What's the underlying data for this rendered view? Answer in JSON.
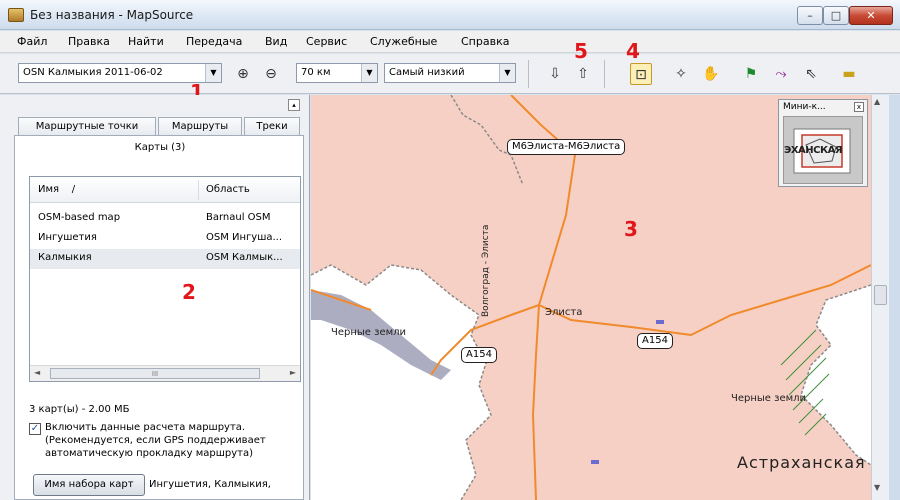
{
  "window": {
    "title": "Без названия - MapSource",
    "min_glyph": "–",
    "max_glyph": "□",
    "close_glyph": "✕"
  },
  "menu": [
    "Файл",
    "Правка",
    "Найти",
    "Передача",
    "Вид",
    "Сервис",
    "Служебные",
    "Справка"
  ],
  "toolbar": {
    "map_product": "OSN Калмыкия 2011-06-02",
    "zoom_scale": "70 км",
    "detail_level": "Самый низкий",
    "icons": [
      "zoom-in-icon",
      "zoom-out-icon",
      "receive-from-device-icon",
      "send-to-device-icon",
      "map-select-tool-icon",
      "zoom-tool-icon",
      "hand-tool-icon",
      "waypoint-flag-icon",
      "route-tool-icon",
      "select-pointer-icon",
      "measure-tool-icon"
    ],
    "combo_arrow": "▼",
    "glyphs": {
      "zoom_in": "⊕",
      "zoom_out": "⊖",
      "receive": "⇩",
      "send": "⇧",
      "map_select": "⊡",
      "zoom_tool": "✧",
      "hand": "✋",
      "flag": "⚑",
      "route": "⤳",
      "pointer": "⇖",
      "measure": "▬"
    }
  },
  "callouts": {
    "c1": "1",
    "c2": "2",
    "c3": "3",
    "c4": "4",
    "c5": "5"
  },
  "left_panel": {
    "collapse_glyph": "▴",
    "tabs": {
      "waypoints": "Маршрутные точки",
      "routes": "Маршруты",
      "tracks": "Треки"
    },
    "maps_tab_title": "Карты (3)",
    "columns": {
      "name": "Имя",
      "sort_glyph": "/",
      "area": "Область"
    },
    "rows": [
      {
        "name": "OSM-based map",
        "area": "Barnaul OSM"
      },
      {
        "name": "Ингушетия",
        "area": "OSM Ингуша..."
      },
      {
        "name": "Калмыкия",
        "area": "OSM Калмык..."
      }
    ],
    "hscroll": {
      "left": "◄",
      "thumb": "III",
      "right": "►"
    },
    "maps_count": "3 карт(ы) - 2.00 МБ",
    "checkbox_checked": true,
    "checkbox_mark": "✓",
    "checkbox_label": "Включить данные расчета маршрута. (Рекомендуется, если GPS поддерживает автоматическую прокладку маршрута)",
    "mapset_button": "Имя набора карт",
    "mapset_value": "Ингушетия, Калмыкия,"
  },
  "map": {
    "labels": {
      "road_top": "M6Элиста-M6Элиста",
      "city": "Элиста",
      "highway_left": "A154",
      "highway_right": "A154",
      "vertical_road": "Волгоград - Элиста",
      "black_lands_left": "Черные земли",
      "black_lands_right": "Черные земли",
      "astrakhan": "Астраханская"
    },
    "colors": {
      "region_fill": "#f6d0c4",
      "outside_fill": "#ffffff",
      "road": "#f08a2c",
      "border": "#8a8a8a",
      "water": "#8a8aa8"
    }
  },
  "vscroll": {
    "up": "▲",
    "down": "▼"
  },
  "minimap": {
    "title": "Мини-к...",
    "close_glyph": "x",
    "label": "ЭХАНСКАЯ"
  }
}
